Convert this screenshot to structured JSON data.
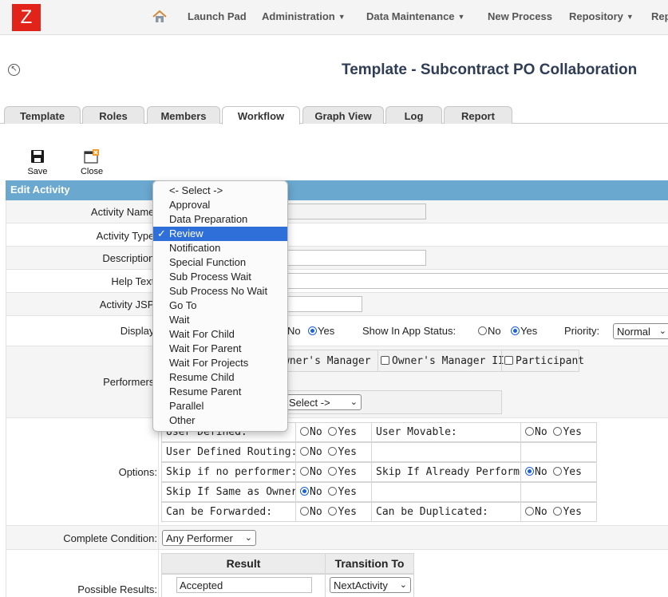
{
  "nav": {
    "logo": "Z",
    "items": [
      {
        "label": "Launch Pad",
        "caret": false
      },
      {
        "label": "Administration",
        "caret": true
      },
      {
        "label": "Data Maintenance",
        "caret": true
      },
      {
        "label": "New Process",
        "caret": false
      },
      {
        "label": "Repository",
        "caret": true
      },
      {
        "label": "Rep",
        "caret": false
      }
    ]
  },
  "page": {
    "title": "Template - Subcontract PO Collaboration"
  },
  "tabs": [
    "Template",
    "Roles",
    "Members",
    "Workflow",
    "Graph View",
    "Log",
    "Report"
  ],
  "active_tab": "Workflow",
  "toolbar": {
    "save": "Save",
    "close": "Close"
  },
  "section": {
    "title": "Edit Activity"
  },
  "labels": {
    "activity_name": "Activity Name:",
    "activity_type": "Activity Type:",
    "description": "Description:",
    "help_text": "Help Text:",
    "activity_jsp": "Activity JSP:",
    "display": "Display:",
    "performers": "Performers:",
    "options": "Options:",
    "complete_condition": "Complete Condition:",
    "possible_results": "Possible Results:"
  },
  "display": {
    "no": "No",
    "yes": "Yes",
    "show_in_app_status": "Show In App Status:",
    "priority": "Priority:",
    "priority_value": "Normal"
  },
  "performers": {
    "owners_manager": "wner's Manager",
    "owners_manager_ii": "Owner's Manager II",
    "participant": "Participant",
    "select_partial": "Select ->"
  },
  "options": {
    "no": "No",
    "yes": "Yes",
    "user_defined": "User Defined:",
    "user_movable": "User Movable:",
    "user_defined_routing": "User Defined Routing:",
    "skip_if_no_performer": "Skip if no performer:",
    "skip_if_already_performed": "Skip If Already Performed:",
    "skip_if_same_as_owner": "Skip If Same as Owner:",
    "can_be_forwarded": "Can be Forwarded:",
    "can_be_duplicated": "Can be Duplicated:"
  },
  "complete_condition_value": "Any Performer",
  "results": {
    "col_result": "Result",
    "col_transition": "Transition To",
    "result_value": "Accepted",
    "transition_value": "NextActivity"
  },
  "activity_type_dropdown": {
    "options": [
      "<- Select ->",
      "Approval",
      "Data Preparation",
      "Review",
      "Notification",
      "Special Function",
      "Sub Process Wait",
      "Sub Process No Wait",
      "Go To",
      "Wait",
      "Wait For Child",
      "Wait For Parent",
      "Wait For Projects",
      "Resume Child",
      "Resume Parent",
      "Parallel",
      "Other"
    ],
    "selected": "Review"
  },
  "colors": {
    "header_blue": "#6aa8cf",
    "logo_red": "#e2231a",
    "highlight": "#2f6fd9"
  }
}
